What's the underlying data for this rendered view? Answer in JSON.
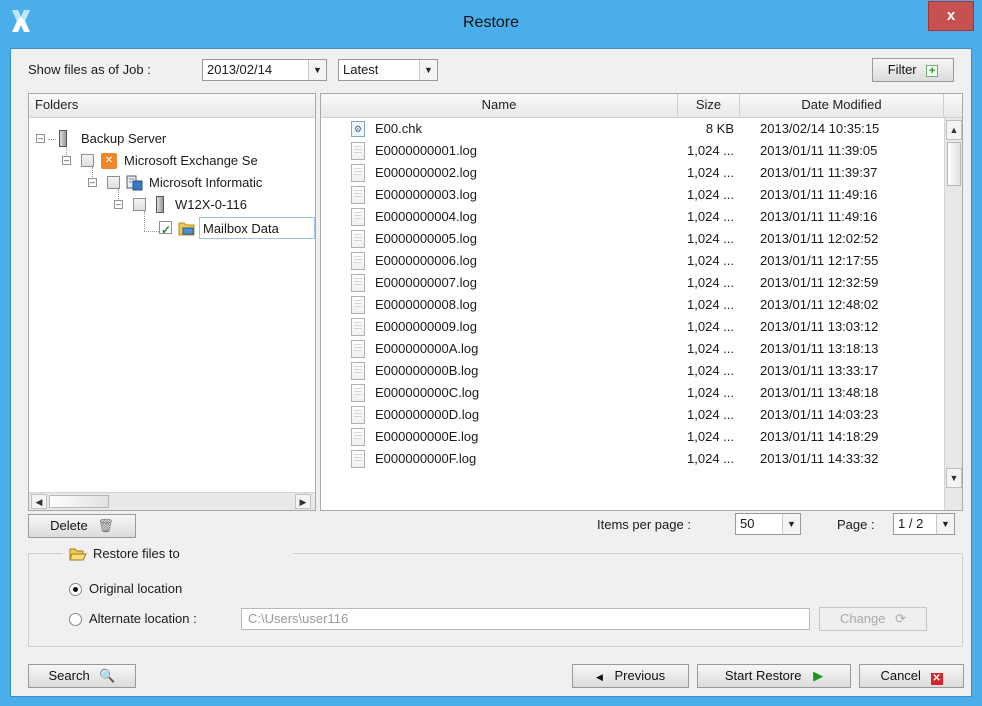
{
  "window": {
    "title": "Restore",
    "close_label": "x"
  },
  "toolbar": {
    "show_files_label": "Show files as of Job :",
    "job_date": "2013/02/14",
    "version": "Latest",
    "filter_label": "Filter"
  },
  "folders": {
    "header": "Folders",
    "nodes": [
      {
        "label": "Backup Server"
      },
      {
        "label": "Microsoft Exchange Se"
      },
      {
        "label": "Microsoft Informatic"
      },
      {
        "label": "W12X-0-116"
      },
      {
        "label": "Mailbox Data"
      }
    ]
  },
  "files": {
    "columns": {
      "name": "Name",
      "size": "Size",
      "date": "Date Modified"
    },
    "rows": [
      {
        "name": "E00.chk",
        "size": "8 KB",
        "date": "2013/02/14 10:35:15"
      },
      {
        "name": "E0000000001.log",
        "size": "1,024 ...",
        "date": "2013/01/11 11:39:05"
      },
      {
        "name": "E0000000002.log",
        "size": "1,024 ...",
        "date": "2013/01/11 11:39:37"
      },
      {
        "name": "E0000000003.log",
        "size": "1,024 ...",
        "date": "2013/01/11 11:49:16"
      },
      {
        "name": "E0000000004.log",
        "size": "1,024 ...",
        "date": "2013/01/11 11:49:16"
      },
      {
        "name": "E0000000005.log",
        "size": "1,024 ...",
        "date": "2013/01/11 12:02:52"
      },
      {
        "name": "E0000000006.log",
        "size": "1,024 ...",
        "date": "2013/01/11 12:17:55"
      },
      {
        "name": "E0000000007.log",
        "size": "1,024 ...",
        "date": "2013/01/11 12:32:59"
      },
      {
        "name": "E0000000008.log",
        "size": "1,024 ...",
        "date": "2013/01/11 12:48:02"
      },
      {
        "name": "E0000000009.log",
        "size": "1,024 ...",
        "date": "2013/01/11 13:03:12"
      },
      {
        "name": "E000000000A.log",
        "size": "1,024 ...",
        "date": "2013/01/11 13:18:13"
      },
      {
        "name": "E000000000B.log",
        "size": "1,024 ...",
        "date": "2013/01/11 13:33:17"
      },
      {
        "name": "E000000000C.log",
        "size": "1,024 ...",
        "date": "2013/01/11 13:48:18"
      },
      {
        "name": "E000000000D.log",
        "size": "1,024 ...",
        "date": "2013/01/11 14:03:23"
      },
      {
        "name": "E000000000E.log",
        "size": "1,024 ...",
        "date": "2013/01/11 14:18:29"
      },
      {
        "name": "E000000000F.log",
        "size": "1,024 ...",
        "date": "2013/01/11 14:33:32"
      }
    ]
  },
  "footer_bar": {
    "delete_label": "Delete",
    "items_per_page_label": "Items per page :",
    "items_per_page": "50",
    "page_label": "Page :",
    "page_value": "1 / 2"
  },
  "restore_to": {
    "title": "Restore files to",
    "original_label": "Original location",
    "alternate_label": "Alternate location :",
    "alternate_value": "C:\\Users\\user116",
    "change_label": "Change"
  },
  "buttons": {
    "search": "Search",
    "previous": "Previous",
    "start_restore": "Start Restore",
    "cancel": "Cancel"
  },
  "colors": {
    "titlebar": "#4aaeea",
    "close": "#c75050",
    "accent_green": "#1a9a1a"
  }
}
